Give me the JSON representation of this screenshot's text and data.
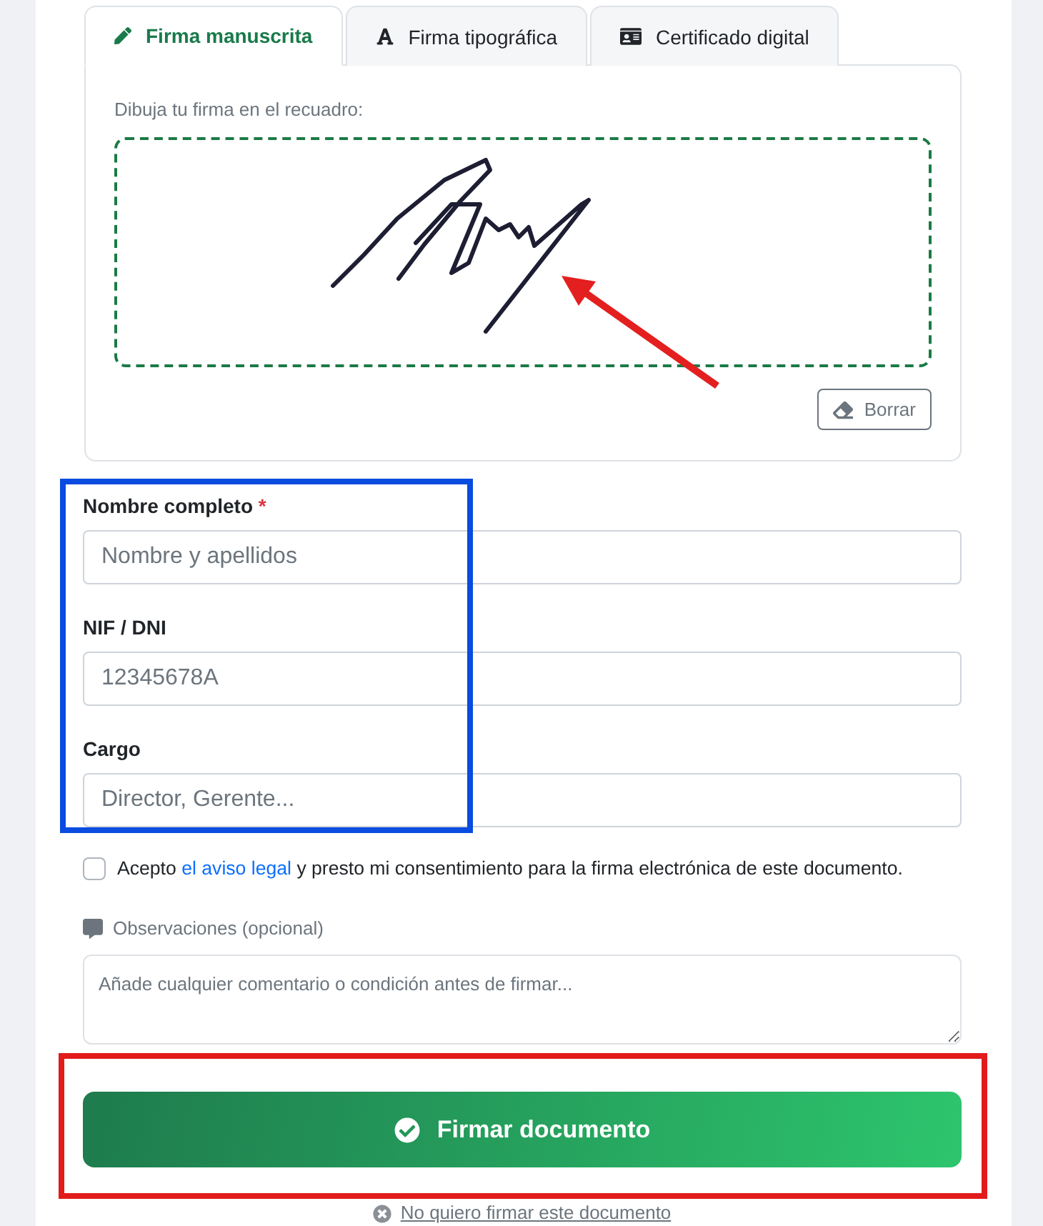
{
  "tabs": [
    {
      "kind": "handwritten",
      "label": "Firma manuscrita",
      "selected": true
    },
    {
      "kind": "typed",
      "label": "Firma tipográfica",
      "selected": false
    },
    {
      "kind": "certificate",
      "label": "Certificado digital",
      "selected": false
    }
  ],
  "signature_pad": {
    "instruction": "Dibuja tu firma en el recuadro:",
    "clear_button": "Borrar"
  },
  "fields": [
    {
      "label": "Nombre completo",
      "required_mark": "*",
      "placeholder": "Nombre y apellidos"
    },
    {
      "label": "NIF / DNI",
      "placeholder": "12345678A"
    },
    {
      "label": "Cargo",
      "placeholder": "Director, Gerente..."
    }
  ],
  "consent": {
    "checked": false,
    "text": "Acepto",
    "link": "el aviso legal",
    "text_after": "y presto mi consentimiento para la firma electrónica de este documento."
  },
  "notes": {
    "label": "Observaciones (opcional)",
    "placeholder": "Añade cualquier comentario o condición antes de firmar..."
  },
  "submit_button": {
    "label": "Firmar documento"
  },
  "decline_link": {
    "label": "No quiero firmar este documento"
  }
}
